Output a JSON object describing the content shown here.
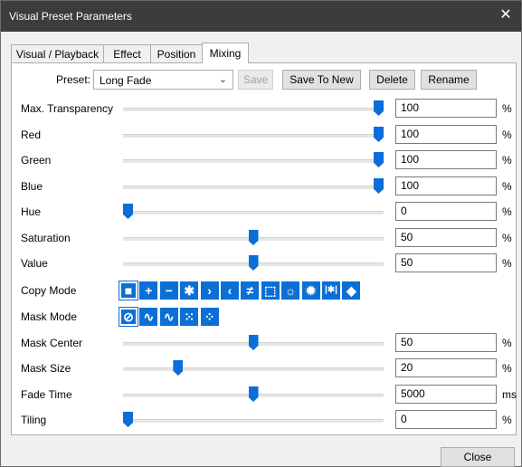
{
  "window": {
    "title": "Visual Preset Parameters",
    "close_glyph": "✕"
  },
  "tabs": [
    {
      "label": "Visual / Playback"
    },
    {
      "label": "Effect"
    },
    {
      "label": "Position"
    },
    {
      "label": "Mixing"
    }
  ],
  "preset": {
    "label": "Preset:",
    "value": "Long Fade",
    "buttons": {
      "save": "Save",
      "save_to_new": "Save To New",
      "delete": "Delete",
      "rename": "Rename"
    }
  },
  "sliders": [
    {
      "label": "Max. Transparency",
      "value": "100",
      "unit": "%",
      "fraction": 1.0
    },
    {
      "label": "Red",
      "value": "100",
      "unit": "%",
      "fraction": 1.0
    },
    {
      "label": "Green",
      "value": "100",
      "unit": "%",
      "fraction": 1.0
    },
    {
      "label": "Blue",
      "value": "100",
      "unit": "%",
      "fraction": 1.0
    },
    {
      "label": "Hue",
      "value": "0",
      "unit": "%",
      "fraction": 0.0
    },
    {
      "label": "Saturation",
      "value": "50",
      "unit": "%",
      "fraction": 0.5
    },
    {
      "label": "Value",
      "value": "50",
      "unit": "%",
      "fraction": 0.5
    }
  ],
  "copy_mode": {
    "label": "Copy Mode",
    "icons": [
      {
        "name": "copy-mode-square-icon",
        "glyph": "■"
      },
      {
        "name": "copy-mode-plus-icon",
        "glyph": "+"
      },
      {
        "name": "copy-mode-minus-icon",
        "glyph": "−"
      },
      {
        "name": "copy-mode-multiply-icon",
        "glyph": "✱"
      },
      {
        "name": "copy-mode-greater-icon",
        "glyph": "›"
      },
      {
        "name": "copy-mode-less-icon",
        "glyph": "‹"
      },
      {
        "name": "copy-mode-not-equal-icon",
        "glyph": "≠"
      },
      {
        "name": "copy-mode-dotted-square-icon",
        "glyph": "⬚"
      },
      {
        "name": "copy-mode-sun-outline-icon",
        "glyph": "☼"
      },
      {
        "name": "copy-mode-sun-filled-icon",
        "glyph": "✹"
      },
      {
        "name": "copy-mode-abs-icon",
        "glyph": "|✱|"
      },
      {
        "name": "copy-mode-layers-icon",
        "glyph": "◆"
      }
    ]
  },
  "mask_mode": {
    "label": "Mask Mode",
    "icons": [
      {
        "name": "mask-mode-none-icon",
        "glyph": "⊘"
      },
      {
        "name": "mask-mode-wave-icon",
        "glyph": "∿"
      },
      {
        "name": "mask-mode-wave-alt-icon",
        "glyph": "∿"
      },
      {
        "name": "mask-mode-dots-icon",
        "glyph": "⁙"
      },
      {
        "name": "mask-mode-dots-alt-icon",
        "glyph": "⁘"
      }
    ]
  },
  "mask_sliders": [
    {
      "label": "Mask Center",
      "value": "50",
      "unit": "%",
      "fraction": 0.5
    },
    {
      "label": "Mask Size",
      "value": "20",
      "unit": "%",
      "fraction": 0.2
    },
    {
      "label": "Fade Time",
      "value": "5000",
      "unit": "ms",
      "fraction": 0.5
    },
    {
      "label": "Tiling",
      "value": "0",
      "unit": "%",
      "fraction": 0.0
    }
  ],
  "footer": {
    "close_label": "Close"
  },
  "colors": {
    "accent": "#0b6fd6",
    "titlebar": "#3c3c3c"
  }
}
